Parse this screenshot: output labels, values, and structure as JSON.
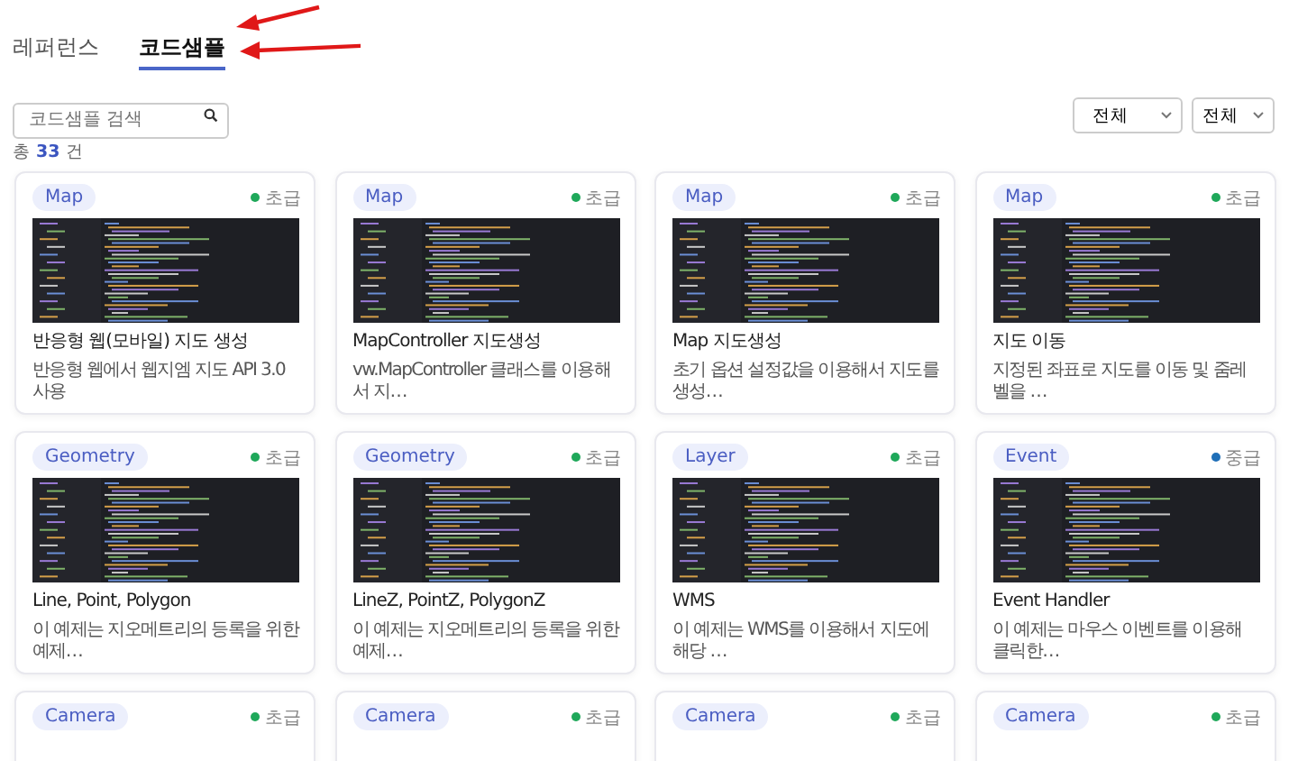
{
  "tabs": [
    {
      "label": "레퍼런스",
      "selected": false
    },
    {
      "label": "코드샘플",
      "selected": true
    }
  ],
  "search": {
    "placeholder": "코드샘플 검색"
  },
  "filters": [
    {
      "value": "전체"
    },
    {
      "value": "전체"
    }
  ],
  "total": {
    "prefix": "총",
    "count": "33",
    "suffix": "건"
  },
  "cards": [
    {
      "tag": "Map",
      "level": "초급",
      "color": "#1fa85a",
      "title": "반응형 웹(모바일) 지도 생성",
      "description": "반응형 웹에서 웹지엠 지도 API 3.0 사용"
    },
    {
      "tag": "Map",
      "level": "초급",
      "color": "#1fa85a",
      "title": "MapController 지도생성",
      "description": "vw.MapController 클래스를 이용해서 지…"
    },
    {
      "tag": "Map",
      "level": "초급",
      "color": "#1fa85a",
      "title": "Map 지도생성",
      "description": "초기 옵션 설정값을 이용해서 지도를 생성…"
    },
    {
      "tag": "Map",
      "level": "초급",
      "color": "#1fa85a",
      "title": "지도 이동",
      "description": "지정된 좌표로 지도를 이동 및 줌레벨을 …"
    },
    {
      "tag": "Geometry",
      "level": "초급",
      "color": "#1fa85a",
      "title": "Line, Point, Polygon",
      "description": "이 예제는 지오메트리의 등록을 위한 예제…"
    },
    {
      "tag": "Geometry",
      "level": "초급",
      "color": "#1fa85a",
      "title": "LineZ, PointZ, PolygonZ",
      "description": "이 예제는 지오메트리의 등록을 위한 예제…"
    },
    {
      "tag": "Layer",
      "level": "초급",
      "color": "#1fa85a",
      "title": "WMS",
      "description": "이 예제는 WMS를 이용해서 지도에 해당 …"
    },
    {
      "tag": "Event",
      "level": "중급",
      "color": "#1f6fb8",
      "title": "Event Handler",
      "description": "이 예제는 마우스 이벤트를 이용해 클릭한…"
    },
    {
      "tag": "Camera",
      "level": "초급",
      "color": "#1fa85a"
    },
    {
      "tag": "Camera",
      "level": "초급",
      "color": "#1fa85a"
    },
    {
      "tag": "Camera",
      "level": "초급",
      "color": "#1fa85a"
    },
    {
      "tag": "Camera",
      "level": "초급",
      "color": "#1fa85a"
    }
  ]
}
